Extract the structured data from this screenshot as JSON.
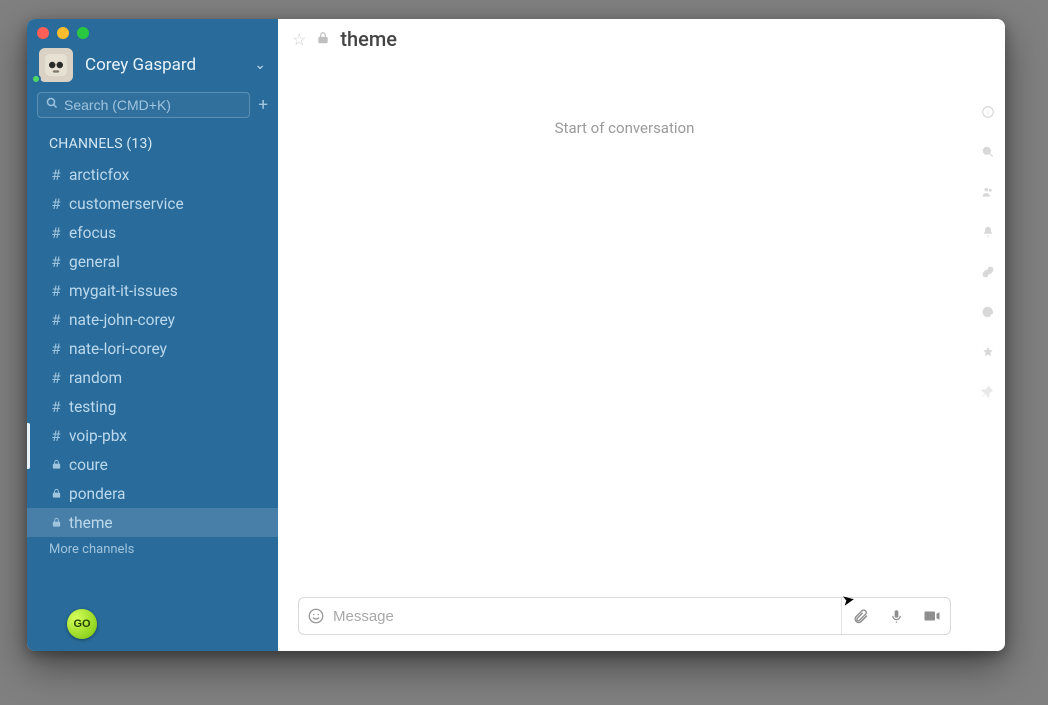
{
  "user": {
    "name": "Corey Gaspard"
  },
  "search": {
    "placeholder": "Search (CMD+K)"
  },
  "channels": {
    "header": "CHANNELS (13)",
    "items": [
      {
        "name": "arcticfox",
        "type": "hash",
        "active": false
      },
      {
        "name": "customerservice",
        "type": "hash",
        "active": false
      },
      {
        "name": "efocus",
        "type": "hash",
        "active": false
      },
      {
        "name": "general",
        "type": "hash",
        "active": false
      },
      {
        "name": "mygait-it-issues",
        "type": "hash",
        "active": false
      },
      {
        "name": "nate-john-corey",
        "type": "hash",
        "active": false
      },
      {
        "name": "nate-lori-corey",
        "type": "hash",
        "active": false
      },
      {
        "name": "random",
        "type": "hash",
        "active": false
      },
      {
        "name": "testing",
        "type": "hash",
        "active": false
      },
      {
        "name": "voip-pbx",
        "type": "hash",
        "active": false
      },
      {
        "name": "coure",
        "type": "lock",
        "active": false
      },
      {
        "name": "pondera",
        "type": "lock",
        "active": false
      },
      {
        "name": "theme",
        "type": "lock",
        "active": true
      }
    ],
    "more": "More channels"
  },
  "footer": {
    "badge": "GO"
  },
  "header": {
    "title": "theme"
  },
  "body": {
    "start": "Start of conversation"
  },
  "compose": {
    "placeholder": "Message"
  }
}
